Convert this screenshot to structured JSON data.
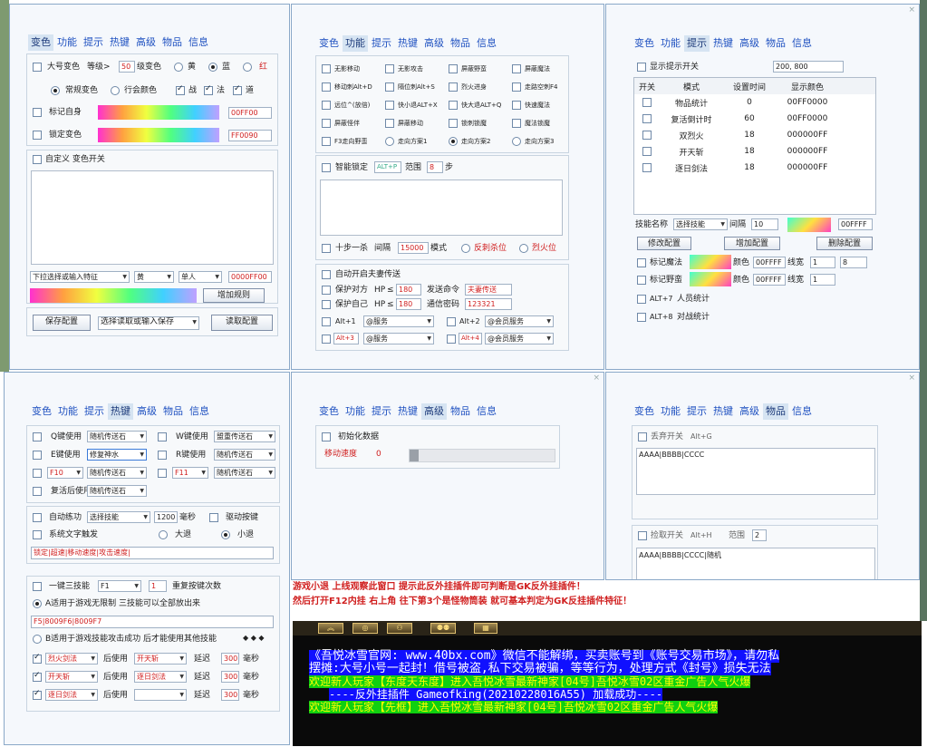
{
  "tabs": [
    "变色",
    "功能",
    "提示",
    "热键",
    "高级",
    "物品",
    "信息"
  ],
  "colors": {
    "tab_text": "#1e50c0",
    "panel_bg": "#f5f8fc",
    "red": "#d02020",
    "chat_blue": "#1010ff",
    "chat_green": "#10d010",
    "chat_yellow": "#ffff00"
  },
  "close_icon": "×",
  "p1": {
    "big_label": "大号变色",
    "level_label": "等级>",
    "level_value": "50",
    "level_suffix": "级变色",
    "yellow": "黄",
    "blue": "蓝",
    "red": "红",
    "normal_color": "常规变色",
    "guild_color": "行会颜色",
    "zhan": "战",
    "fa": "法",
    "dao": "道",
    "mark_self": "标记自身",
    "mark_self_value": "00FF00",
    "lock_color": "锁定变色",
    "lock_color_value": "FF0090",
    "custom": "自定义 变色开关",
    "dropdown_feature": "下拉选择或输入特征",
    "color_sel": "黄",
    "person_sel": "单人",
    "color_value": "0000FF00",
    "add_rule": "增加规则",
    "save_cfg": "保存配置",
    "select_read": "选择读取或输入保存",
    "read_cfg": "读取配置"
  },
  "p2": {
    "grid": [
      [
        {
          "t": "无影移动",
          "k": "cb"
        },
        {
          "t": "无影攻击",
          "k": "cb"
        },
        {
          "t": "屏蔽野蛮",
          "k": "cb"
        },
        {
          "t": "屏蔽魔法",
          "k": "cb"
        }
      ],
      [
        {
          "t": "移动刺Alt+D",
          "k": "cb"
        },
        {
          "t": "隔位刺Alt+S",
          "k": "cb"
        },
        {
          "t": "烈火进身",
          "k": "cb"
        },
        {
          "t": "走路空刺F4",
          "k": "cb"
        }
      ],
      [
        {
          "t": "远位^(放倍)",
          "k": "cb"
        },
        {
          "t": "快小退ALT+X",
          "k": "cb"
        },
        {
          "t": "快大退ALT+Q",
          "k": "cb"
        },
        {
          "t": "快速魔法",
          "k": "cb"
        }
      ],
      [
        {
          "t": "屏蔽怪伴",
          "k": "cb"
        },
        {
          "t": "屏蔽移动",
          "k": "cb"
        },
        {
          "t": "锁刺锁魔",
          "k": "cb"
        },
        {
          "t": "魔法锁魔",
          "k": "cb"
        }
      ],
      [
        {
          "t": "F3走向野蛮",
          "k": "cb"
        },
        {
          "t": "走向方案1",
          "k": "rd"
        },
        {
          "t": "走向方案2",
          "k": "rd",
          "on": true
        },
        {
          "t": "走向方案3",
          "k": "rd"
        }
      ]
    ],
    "smart_lock": "智能锁定",
    "smart_lock_key": "ALT+P",
    "range": "范围",
    "range_value": "8",
    "step": "步",
    "ten_step": "十步一杀",
    "interval": "间隔",
    "interval_value": "15000",
    "mode": "模式",
    "anti_kill": "反刺杀位",
    "fire": "烈火位",
    "auto_wife": "自动开启夫妻传送",
    "protect_other": "保护对方",
    "hp": "HP",
    "hp_val1": "180",
    "send_cmd": "发送命令",
    "send_cmd_val": "夫妻传送",
    "protect_self": "保护自己",
    "hp_val2": "180",
    "comm_pwd": "通信密码",
    "comm_pwd_val": "123321",
    "alt1": "Alt+1",
    "alt2": "Alt+2",
    "alt3": "Alt+3",
    "alt4": "Alt+4",
    "service": "@服务",
    "vip_service": "@会员服务"
  },
  "p3": {
    "tip_switch": "显示提示开关",
    "tip_pos": "200, 800",
    "cols": [
      "开关",
      "模式",
      "设置时间",
      "显示颜色"
    ],
    "rows": [
      [
        "物品统计",
        "0",
        "00FF0000"
      ],
      [
        "复活倒计时",
        "60",
        "00FF0000"
      ],
      [
        "双烈火",
        "18",
        "000000FF"
      ],
      [
        "开天斩",
        "18",
        "000000FF"
      ],
      [
        "逐日剑法",
        "18",
        "000000FF"
      ]
    ],
    "skill_name": "技能名称",
    "skill_select": "选择技能",
    "interval": "间隔",
    "interval_value": "10",
    "skill_color": "00FFFF",
    "modify_cfg": "修改配置",
    "add_cfg": "增加配置",
    "del_cfg": "删除配置",
    "mark_magic": "标记魔法",
    "mark_savage": "标记野蛮",
    "color": "颜色",
    "color_value": "00FFFF",
    "line_width": "线宽",
    "lw1": "1",
    "lw1b": "8",
    "lw2": "1",
    "alt7": "ALT+7",
    "person_count": "人员统计",
    "alt8": "ALT+8",
    "battle_count": "对战统计"
  },
  "p4": {
    "rows": [
      {
        "a": "Q键使用",
        "av": "随机传送石",
        "b": "W键使用",
        "bv": "盟重传送石"
      },
      {
        "a": "E键使用",
        "av": "修复神水",
        "b": "R键使用",
        "bv": "随机传送石"
      },
      {
        "a": "F10",
        "av": "随机传送石",
        "b": "F11",
        "bv": "随机传送石"
      }
    ],
    "revive": "复活后使用",
    "revive_val": "随机传送石",
    "auto_train": "自动练功",
    "skill_select": "选择技能",
    "ms_value": "1200",
    "ms": "毫秒",
    "drive_key": "驱动按键",
    "sys_text": "系统文字触发",
    "big_back": "大退",
    "small_back": "小退",
    "lock_text": "锁定|超速|移动速度|攻击速度|",
    "one_key": "一键三技能",
    "f1": "F1",
    "repeat_val": "1",
    "repeat": "重复按键次数",
    "mode_a": "A适用于游戏无限制 三技能可以全部放出来",
    "mode_a_val": "F5|8009F6|8009F7",
    "mode_b": "B适用于游戏技能攻击成功 后才能使用其他技能",
    "combo": [
      {
        "s": "烈火剑法",
        "u": "后使用",
        "v": "开天斩",
        "d": "延迟",
        "ms": "300",
        "m": "毫秒"
      },
      {
        "s": "开天斩",
        "u": "后使用",
        "v": "逐日剑法",
        "d": "延迟",
        "ms": "300",
        "m": "毫秒"
      },
      {
        "s": "逐日剑法",
        "u": "后使用",
        "v": "",
        "d": "延迟",
        "ms": "300",
        "m": "毫秒"
      }
    ]
  },
  "p5": {
    "init": "初始化数据",
    "move_speed": "移动速度",
    "move_speed_val": "0"
  },
  "p6": {
    "discard": "丢弃开关",
    "discard_key": "Alt+G",
    "discard_list": "AAAA|BBBB|CCCC",
    "pickup": "捡取开关",
    "pickup_key": "Alt+H",
    "range": "范围",
    "range_val": "2",
    "pickup_list": "AAAA|BBBB|CCCC|随机"
  },
  "notes": {
    "line1": "游戏小退 上线观察此窗口 提示此反外挂插件即可判断是GK反外挂插件！",
    "line2": "然后打开F12内挂 右上角 往下第3个是怪物筒装 就可基本判定为GK反挂插件特征！"
  },
  "chat": {
    "line1": "《吾悦冰雪官网: www.40bx.com》微信不能解绑，买卖账号到《账号交易市场》，请勿私",
    "line2": "摆摊:大号小号一起封！借号被盗,私下交易被骗，等等行为，处理方式《封号》损失无法",
    "line3": "欢迎新人玩家【东度天东度】进入吾悦冰雪最新神家[04号]吾悦冰雪02区重金广告人气火爆",
    "line4": "----反外挂插件 Gameofking(20210228016A55) 加载成功----",
    "line5": "欢迎新人玩家【先框】进入吾悦冰雪最新神家[04号]吾悦冰雪02区重金广告人气火爆"
  }
}
